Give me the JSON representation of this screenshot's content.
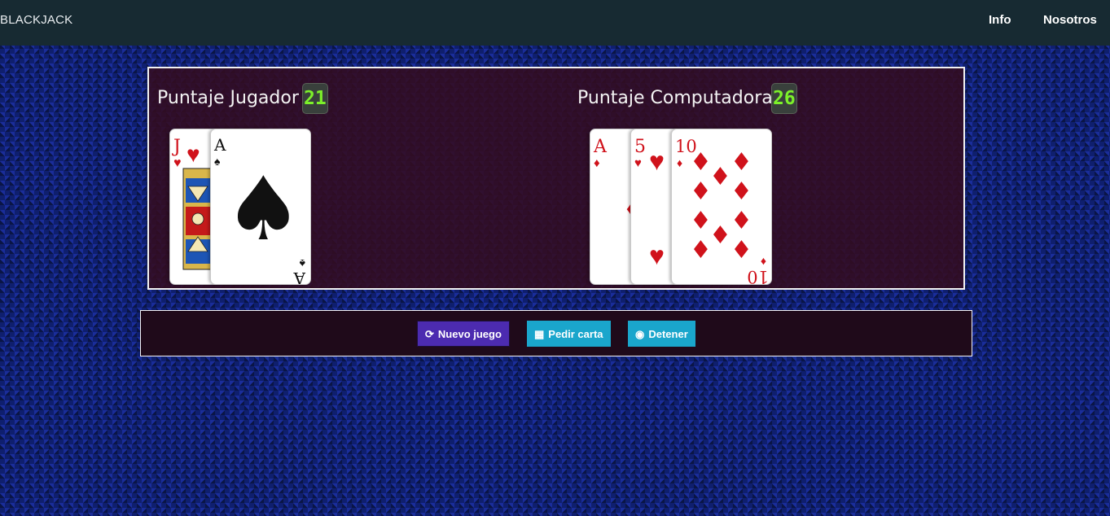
{
  "navbar": {
    "brand": "BLACKJACK",
    "links": [
      "Info",
      "Nosotros"
    ]
  },
  "player": {
    "label": "Puntaje Jugador",
    "score": "21",
    "cards": [
      {
        "rank": "J",
        "suit": "hearts"
      },
      {
        "rank": "A",
        "suit": "spades"
      }
    ]
  },
  "computer": {
    "label": "Puntaje Computadora",
    "score": "26",
    "cards": [
      {
        "rank": "A",
        "suit": "diamonds"
      },
      {
        "rank": "5",
        "suit": "hearts"
      },
      {
        "rank": "10",
        "suit": "diamonds"
      }
    ]
  },
  "controls": {
    "new_game": {
      "label": "Nuevo juego",
      "icon": "refresh-icon"
    },
    "hit": {
      "label": "Pedir carta",
      "icon": "table-icon"
    },
    "stop": {
      "label": "Detener",
      "icon": "stop-circle-icon"
    }
  },
  "colors": {
    "navbar": "#172a32",
    "score_text": "#7cf02a",
    "new_game_button": "#4c2bb0",
    "action_button": "#1aa6cc",
    "red_suit": "#d0121b"
  }
}
